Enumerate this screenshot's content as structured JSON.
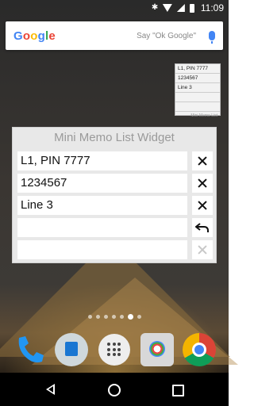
{
  "status_bar": {
    "time": "11:09",
    "icons": [
      "bluetooth-icon",
      "wifi-icon",
      "signal-icon",
      "battery-icon"
    ]
  },
  "search_bar": {
    "logo": "Google",
    "hint": "Say \"Ok Google\"",
    "icons": [
      "microphone-icon"
    ]
  },
  "preview_widget": {
    "rows": [
      "L1, PIN 7777",
      "1234567",
      "Line 3",
      "",
      ""
    ],
    "footer": "Mini Memo List"
  },
  "memo_widget": {
    "title": "Mini Memo List Widget",
    "rows": [
      {
        "text": "L1, PIN 7777",
        "action": "delete",
        "icon": "close-icon"
      },
      {
        "text": "1234567",
        "action": "delete",
        "icon": "close-icon"
      },
      {
        "text": "Line 3",
        "action": "delete",
        "icon": "close-icon"
      },
      {
        "text": "",
        "action": "undo",
        "icon": "undo-icon"
      },
      {
        "text": "",
        "action": "delete-disabled",
        "icon": "close-icon"
      }
    ]
  },
  "home": {
    "page_count": 7,
    "active_page": 6,
    "dock_apps": [
      "phone",
      "messenger",
      "app-drawer",
      "camera",
      "chrome"
    ]
  },
  "nav_bar": {
    "icons": [
      "back-icon",
      "home-icon",
      "recents-icon"
    ]
  }
}
